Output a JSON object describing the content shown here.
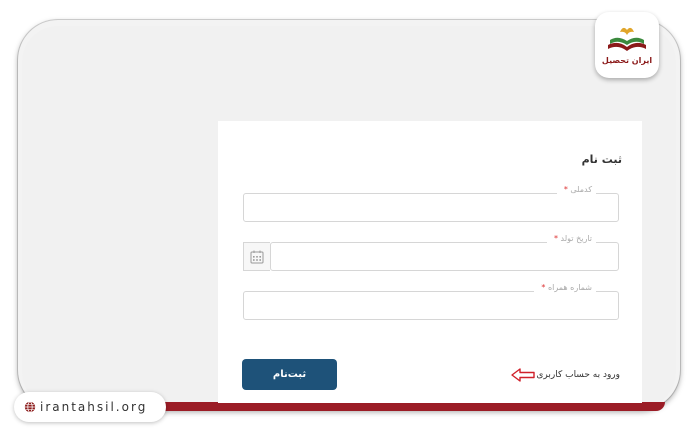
{
  "brand": {
    "logo_text": "ایران تحصیل",
    "url_text": "irantahsil.org",
    "accent_red": "#9b1c26",
    "button_blue": "#1e5279"
  },
  "form": {
    "title": "ثبت نام",
    "fields": [
      {
        "label": "کدملی",
        "required_mark": "*",
        "value": "",
        "placeholder": ""
      },
      {
        "label": "تاریخ تولد",
        "required_mark": "*",
        "value": "",
        "placeholder": "",
        "icon": "calendar-icon"
      },
      {
        "label": "شماره همراه",
        "required_mark": "*",
        "value": "",
        "placeholder": ""
      }
    ],
    "submit_label": "ثبت‌نام",
    "login_link": "ورود به حساب کاربری"
  }
}
